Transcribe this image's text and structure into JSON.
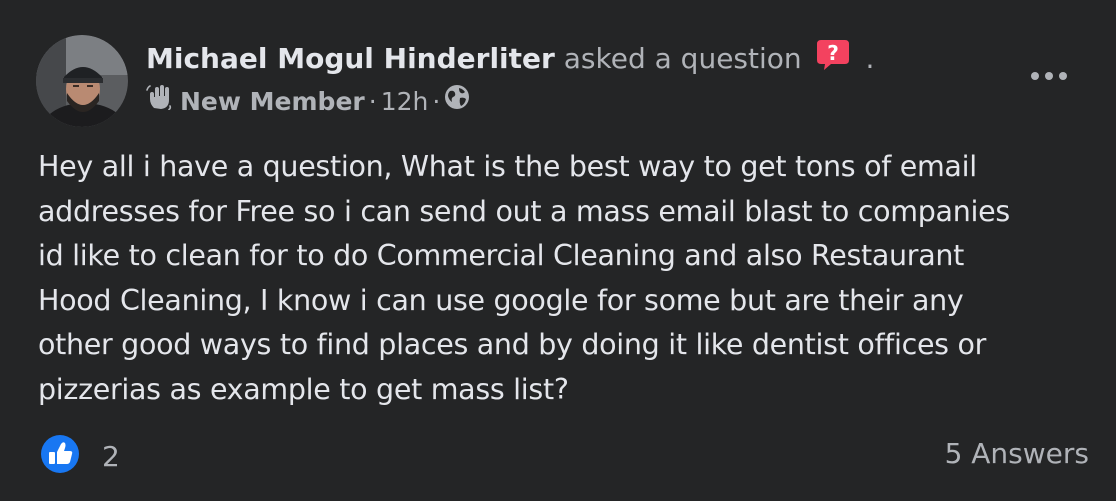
{
  "post": {
    "author_name": "Michael Mogul Hinderliter",
    "action_text": "asked a question",
    "period": ".",
    "badge": "New Member",
    "separator": "·",
    "time": "12h",
    "body": "Hey all i have a question,  What is the best way to get tons of email\naddresses for Free so i can send out a mass email blast to companies\nid like to clean for to do Commercial Cleaning and also Restaurant\nHood Cleaning,   I know i can use google for some but are their any\nother good ways to find places and by doing it like dentist offices or\npizzerias as example to get mass list?",
    "like_count": "2",
    "answers_label": "5 Answers"
  },
  "icons": {
    "question": "question-badge-icon",
    "member": "waving-hand-icon",
    "audience": "globe-icon",
    "more": "more-options-icon",
    "like": "like-icon"
  },
  "colors": {
    "background": "#242526",
    "primary_text": "#e4e6eb",
    "secondary_text": "#b0b3b8",
    "question_badge": "#f3425f",
    "like_blue": "#1877f2"
  }
}
